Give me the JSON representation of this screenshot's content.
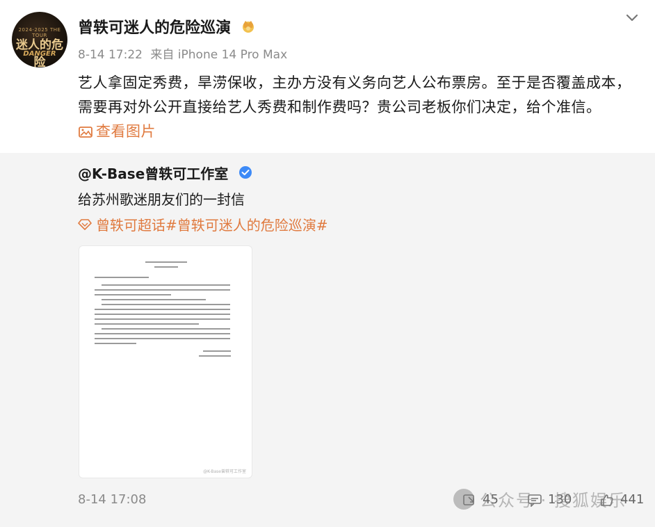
{
  "header": {
    "avatar": {
      "line1": "2024-2025 THE TOUR",
      "line2": "迷人的危险",
      "line3": "DANGER"
    },
    "username": "曾轶可迷人的危险巡演",
    "time": "8-14 17:22",
    "source": "来自 iPhone 14 Pro Max"
  },
  "post": {
    "text": "艺人拿固定秀费，旱涝保收，主办方没有义务向艺人公布票房。至于是否覆盖成本，需要再对外公开直接给艺人秀费和制作费吗？贵公司老板你们决定，给个准信。",
    "view_image_label": "查看图片"
  },
  "repost": {
    "author": "@K-Base曾轶可工作室",
    "text": "给苏州歌迷朋友们的一封信",
    "topic": "曾轶可超话#曾轶可迷人的危险巡演#",
    "doc_watermark": "@K-Base曾轶可工作室",
    "time": "8-14 17:08",
    "actions": {
      "repost_count": "45",
      "comment_count": "130",
      "like_count": "441"
    }
  },
  "watermark": {
    "text": "公众号 · 搜狐娱乐"
  },
  "colors": {
    "accent": "#e07a3f",
    "verified": "#3d8af7",
    "meta": "#8a8a8a",
    "repost_bg": "#f4f4f4"
  }
}
